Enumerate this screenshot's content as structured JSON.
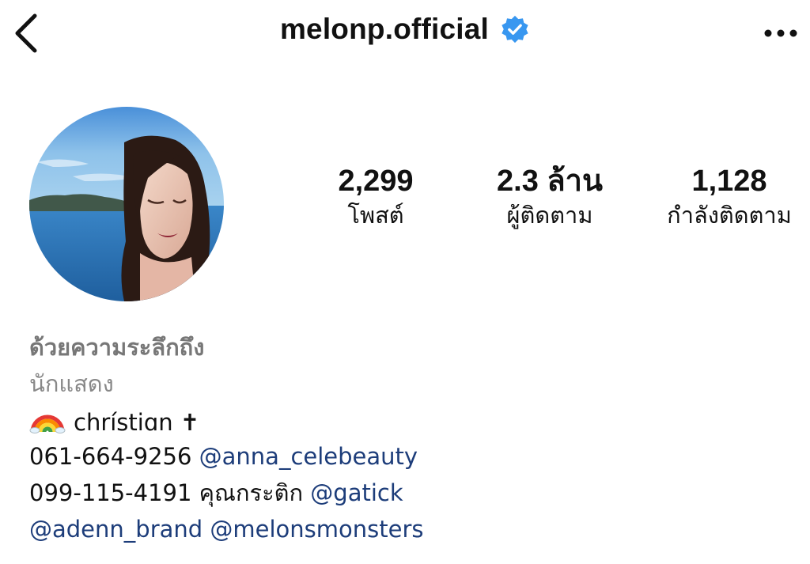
{
  "header": {
    "username": "melonp.official",
    "back_icon": "chevron-left-icon",
    "verified_icon": "verified-badge-icon",
    "more_icon": "more-horizontal-icon"
  },
  "stats": {
    "posts": {
      "value": "2,299",
      "label": "โพสต์"
    },
    "followers": {
      "value": "2.3 ล้าน",
      "label": "ผู้ติดตาม"
    },
    "following": {
      "value": "1,128",
      "label": "กำลังติดตาม"
    }
  },
  "bio": {
    "name": "ด้วยความระลึกถึง",
    "category": "นักแสดง",
    "line1": {
      "emoji_icon": "rainbow-icon",
      "text": "chrístiɑn ✝"
    },
    "line2": {
      "phone": "061-664-9256",
      "mention": "@anna_celebeauty"
    },
    "line3": {
      "phone": "099-115-4191",
      "text": "คุณกระติก",
      "mention": "@gatick"
    },
    "line4": {
      "mention1": "@adenn_brand",
      "mention2": "@melonsmonsters"
    }
  },
  "colors": {
    "link": "#1d3d7a",
    "verified": "#3897f0",
    "muted": "#777777"
  }
}
